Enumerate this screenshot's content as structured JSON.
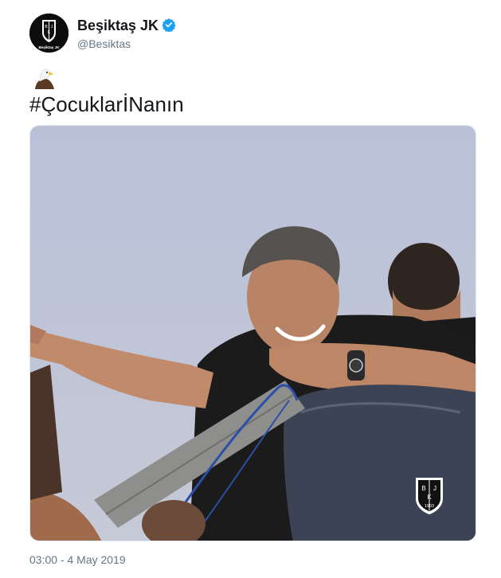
{
  "author": {
    "display_name": "Beşiktaş JK",
    "handle": "@Besiktas",
    "verified": true,
    "avatar_icon": "besiktas-crest-icon",
    "avatar_caption": "Beşiktaş JK"
  },
  "tweet": {
    "emoji_icon": "eagle-icon",
    "text": "#ÇocuklarİNanın",
    "timestamp": "03:00 - 4 May 2019"
  },
  "media": {
    "watermark_icon": "besiktas-crest-icon",
    "crest_letters": [
      "B",
      "J",
      "K"
    ],
    "crest_year": "1903"
  },
  "colors": {
    "verified_blue": "#1da1f2",
    "sky": "#bcc3d8",
    "muted_text": "#657786"
  }
}
